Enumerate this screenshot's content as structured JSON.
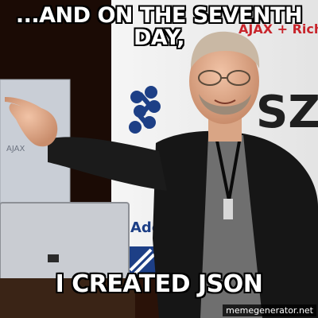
{
  "meme": {
    "top_text_line1": "...AND ON THE SEVENTH",
    "top_text_line2": "DAY,",
    "bottom_text": "I CREATED JSON",
    "watermark": "memegenerator.net"
  },
  "background": {
    "banner_left_text": "AJAX",
    "banner_top_text": "AJAX + Rich",
    "banner_right_text": "SZ",
    "sign_text": "Adc"
  },
  "colors": {
    "caption_text": "#ffffff",
    "caption_outline": "#000000",
    "curtain": "#2a1208",
    "banner": "#f2f2f2",
    "logo_blue": "#1d3f86",
    "jacket": "#161616"
  }
}
